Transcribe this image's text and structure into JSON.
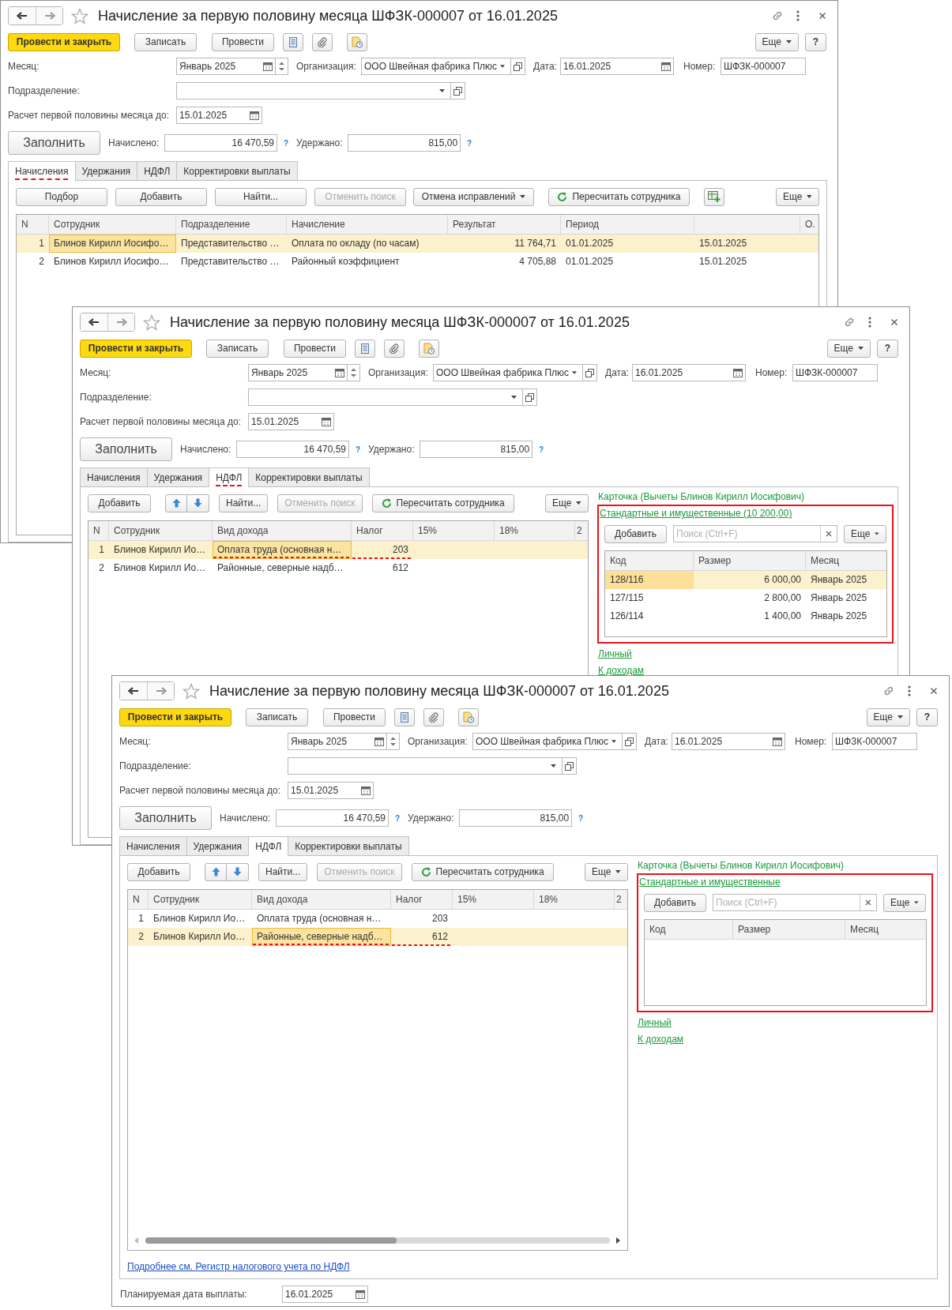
{
  "windows": [
    {
      "title": "Начисление за первую половину месяца ШФЗК-000007 от 16.01.2025",
      "toolbar": {
        "post_close": "Провести и закрыть",
        "save": "Записать",
        "post": "Провести",
        "more": "Еще",
        "help": "?"
      },
      "header": {
        "month_label": "Месяц:",
        "month": "Январь 2025",
        "org_label": "Организация:",
        "org": "ООО Швейная фабрика Плюс",
        "date_label": "Дата:",
        "date": "16.01.2025",
        "number_label": "Номер:",
        "number": "ШФЗК-000007",
        "division_label": "Подразделение:",
        "until_label": "Расчет первой половины месяца до:",
        "until": "15.01.2025",
        "fill": "Заполнить",
        "accrued_label": "Начислено:",
        "accrued": "16 470,59",
        "accrued_hint": "?",
        "withheld_label": "Удержано:",
        "withheld": "815,00",
        "withheld_hint": "?"
      },
      "tabs": [
        {
          "label": "Начисления",
          "selected": true,
          "underlined": true
        },
        {
          "label": "Удержания",
          "selected": false,
          "underlined": false
        },
        {
          "label": "НДФЛ",
          "selected": false,
          "underlined": false
        },
        {
          "label": "Корректировки выплаты",
          "selected": false,
          "underlined": false
        }
      ],
      "panel": {
        "kind": "accruals",
        "buttons": [
          {
            "kind": "text",
            "label": "Подбор",
            "disabled": false
          },
          {
            "kind": "text",
            "label": "Добавить",
            "disabled": false
          },
          {
            "kind": "text",
            "label": "Найти...",
            "disabled": false
          },
          {
            "kind": "text",
            "label": "Отменить поиск",
            "disabled": true
          },
          {
            "kind": "menu",
            "label": "Отмена исправлений",
            "disabled": false
          },
          {
            "kind": "refresh",
            "label": "Пересчитать сотрудника",
            "disabled": false
          },
          {
            "kind": "add-table",
            "disabled": false
          },
          {
            "kind": "more",
            "label": "Еще",
            "disabled": false
          }
        ],
        "columns": [
          {
            "label": "N"
          },
          {
            "label": "Сотрудник"
          },
          {
            "label": "Подразделение"
          },
          {
            "label": "Начисление"
          },
          {
            "label": "Результат"
          },
          {
            "label": "Период"
          },
          {},
          {
            "label": "О."
          }
        ],
        "rows": [
          {
            "selected": true,
            "cells": [
              {
                "text": "1",
                "focused": false
              },
              {
                "text": "Блинов Кирилл Иосифо…",
                "focused": true
              },
              {
                "text": "Представительство …",
                "focused": false
              },
              {
                "text": "Оплата по окладу (по часам)",
                "focused": false
              },
              {
                "text": "11 764,71",
                "focused": false
              },
              {
                "text": "01.01.2025",
                "focused": false
              },
              {
                "text": "15.01.2025",
                "focused": false
              }
            ]
          },
          {
            "selected": false,
            "cells": [
              {
                "text": "2",
                "focused": false
              },
              {
                "text": "Блинов Кирилл Иосифо…",
                "focused": false
              },
              {
                "text": "Представительство …",
                "focused": false
              },
              {
                "text": "Районный коэффициент",
                "focused": false
              },
              {
                "text": "4 705,88",
                "focused": false
              },
              {
                "text": "01.01.2025",
                "focused": false
              },
              {
                "text": "15.01.2025",
                "focused": false
              }
            ]
          }
        ]
      }
    },
    {
      "title": "Начисление за первую половину месяца ШФЗК-000007 от 16.01.2025",
      "toolbar": {
        "post_close": "Провести и закрыть",
        "save": "Записать",
        "post": "Провести",
        "more": "Еще",
        "help": "?"
      },
      "header": {
        "month_label": "Месяц:",
        "month": "Январь 2025",
        "org_label": "Организация:",
        "org": "ООО Швейная фабрика Плюс",
        "date_label": "Дата:",
        "date": "16.01.2025",
        "number_label": "Номер:",
        "number": "ШФЗК-000007",
        "division_label": "Подразделение:",
        "until_label": "Расчет первой половины месяца до:",
        "until": "15.01.2025",
        "fill": "Заполнить",
        "accrued_label": "Начислено:",
        "accrued": "16 470,59",
        "accrued_hint": "?",
        "withheld_label": "Удержано:",
        "withheld": "815,00",
        "withheld_hint": "?"
      },
      "tabs": [
        {
          "label": "Начисления",
          "selected": false,
          "underlined": false
        },
        {
          "label": "Удержания",
          "selected": false,
          "underlined": false
        },
        {
          "label": "НДФЛ",
          "selected": true,
          "underlined": true
        },
        {
          "label": "Корректировки выплаты",
          "selected": false,
          "underlined": false
        }
      ],
      "panel": {
        "kind": "ndfl",
        "buttons": [
          {
            "kind": "text",
            "label": "Добавить",
            "disabled": false
          },
          {
            "kind": "arrows",
            "disabled": false
          },
          {
            "kind": "text",
            "label": "Найти...",
            "disabled": false
          },
          {
            "kind": "text",
            "label": "Отменить поиск",
            "disabled": true
          },
          {
            "kind": "refresh",
            "label": "Пересчитать сотрудника",
            "disabled": false
          },
          {
            "kind": "more",
            "label": "Еще",
            "disabled": false
          }
        ],
        "columns": [
          {
            "label": "N"
          },
          {
            "label": "Сотрудник"
          },
          {
            "label": "Вид дохода"
          },
          {
            "label": "Налог"
          },
          {
            "label": "15%"
          },
          {
            "label": "18%"
          },
          {
            "label": "2"
          }
        ],
        "rows": [
          {
            "selected": true,
            "cells": [
              {
                "text": "1",
                "focused": false,
                "underlined": false
              },
              {
                "text": "Блинов Кирилл Ио…",
                "focused": false,
                "underlined": false
              },
              {
                "text": "Оплата труда (основная н…",
                "focused": true,
                "underlined": true
              },
              {
                "text": "203",
                "focused": false,
                "underlined": true
              }
            ]
          },
          {
            "selected": false,
            "cells": [
              {
                "text": "2",
                "focused": false,
                "underlined": false
              },
              {
                "text": "Блинов Кирилл Ио…",
                "focused": false,
                "underlined": false
              },
              {
                "text": "Районные, северные надб…",
                "focused": false,
                "underlined": false
              },
              {
                "text": "612",
                "focused": false,
                "underlined": false
              }
            ]
          }
        ],
        "side": {
          "card_title": "Карточка (Вычеты Блинов Кирилл Иосифович)",
          "framed": true,
          "section_link": "Стандартные и имущественные (10 200,00)",
          "add": "Добавить",
          "search_placeholder": "Поиск (Ctrl+F)",
          "more": "Еще",
          "columns": [
            {
              "label": "Код"
            },
            {
              "label": "Размер"
            },
            {
              "label": "Месяц"
            }
          ],
          "rows": [
            {
              "selected": true,
              "cells": [
                {
                  "text": "128/116",
                  "focused": true
                },
                {
                  "text": "6 000,00",
                  "focused": false
                },
                {
                  "text": "Январь 2025",
                  "focused": false
                }
              ]
            },
            {
              "selected": false,
              "cells": [
                {
                  "text": "127/115",
                  "focused": false
                },
                {
                  "text": "2 800,00",
                  "focused": false
                },
                {
                  "text": "Январь 2025",
                  "focused": false
                }
              ]
            },
            {
              "selected": false,
              "cells": [
                {
                  "text": "126/114",
                  "focused": false
                },
                {
                  "text": "1 400,00",
                  "focused": false
                },
                {
                  "text": "Январь 2025",
                  "focused": false
                }
              ]
            }
          ],
          "links": [
            "Личный",
            "К доходам"
          ]
        }
      }
    },
    {
      "title": "Начисление за первую половину месяца ШФЗК-000007 от 16.01.2025",
      "toolbar": {
        "post_close": "Провести и закрыть",
        "save": "Записать",
        "post": "Провести",
        "more": "Еще",
        "help": "?"
      },
      "header": {
        "month_label": "Месяц:",
        "month": "Январь 2025",
        "org_label": "Организация:",
        "org": "ООО Швейная фабрика Плюс",
        "date_label": "Дата:",
        "date": "16.01.2025",
        "number_label": "Номер:",
        "number": "ШФЗК-000007",
        "division_label": "Подразделение:",
        "until_label": "Расчет первой половины месяца до:",
        "until": "15.01.2025",
        "fill": "Заполнить",
        "accrued_label": "Начислено:",
        "accrued": "16 470,59",
        "accrued_hint": "?",
        "withheld_label": "Удержано:",
        "withheld": "815,00",
        "withheld_hint": "?"
      },
      "tabs": [
        {
          "label": "Начисления",
          "selected": false,
          "underlined": false
        },
        {
          "label": "Удержания",
          "selected": false,
          "underlined": false
        },
        {
          "label": "НДФЛ",
          "selected": true,
          "underlined": false
        },
        {
          "label": "Корректировки выплаты",
          "selected": false,
          "underlined": false
        }
      ],
      "panel": {
        "kind": "ndfl",
        "buttons": [
          {
            "kind": "text",
            "label": "Добавить",
            "disabled": false
          },
          {
            "kind": "arrows",
            "disabled": false
          },
          {
            "kind": "text",
            "label": "Найти...",
            "disabled": false
          },
          {
            "kind": "text",
            "label": "Отменить поиск",
            "disabled": true
          },
          {
            "kind": "refresh",
            "label": "Пересчитать сотрудника",
            "disabled": false
          },
          {
            "kind": "more",
            "label": "Еще",
            "disabled": false
          }
        ],
        "columns": [
          {
            "label": "N"
          },
          {
            "label": "Сотрудник"
          },
          {
            "label": "Вид дохода"
          },
          {
            "label": "Налог"
          },
          {
            "label": "15%"
          },
          {
            "label": "18%"
          },
          {
            "label": "2"
          }
        ],
        "rows": [
          {
            "selected": false,
            "cells": [
              {
                "text": "1",
                "focused": false,
                "underlined": false
              },
              {
                "text": "Блинов Кирилл Ио…",
                "focused": false,
                "underlined": false
              },
              {
                "text": "Оплата труда (основная н…",
                "focused": false,
                "underlined": false
              },
              {
                "text": "203",
                "focused": false,
                "underlined": false
              }
            ]
          },
          {
            "selected": true,
            "cells": [
              {
                "text": "2",
                "focused": false,
                "underlined": false
              },
              {
                "text": "Блинов Кирилл Ио…",
                "focused": false,
                "underlined": false
              },
              {
                "text": "Районные, северные надб…",
                "focused": true,
                "underlined": true
              },
              {
                "text": "612",
                "focused": false,
                "underlined": true
              }
            ]
          }
        ],
        "side": {
          "card_title": "Карточка (Вычеты Блинов Кирилл Иосифович)",
          "framed": true,
          "section_link": "Стандартные и имущественные",
          "add": "Добавить",
          "search_placeholder": "Поиск (Ctrl+F)",
          "more": "Еще",
          "columns": [
            {
              "label": "Код"
            },
            {
              "label": "Размер"
            },
            {
              "label": "Месяц"
            }
          ],
          "links": [
            "Личный",
            "К доходам"
          ]
        }
      },
      "footer": {
        "link": "Подробнее см. Регистр налогового учета по НДФЛ",
        "pay_date_label": "Планируемая дата выплаты:",
        "pay_date": "16.01.2025"
      }
    }
  ]
}
